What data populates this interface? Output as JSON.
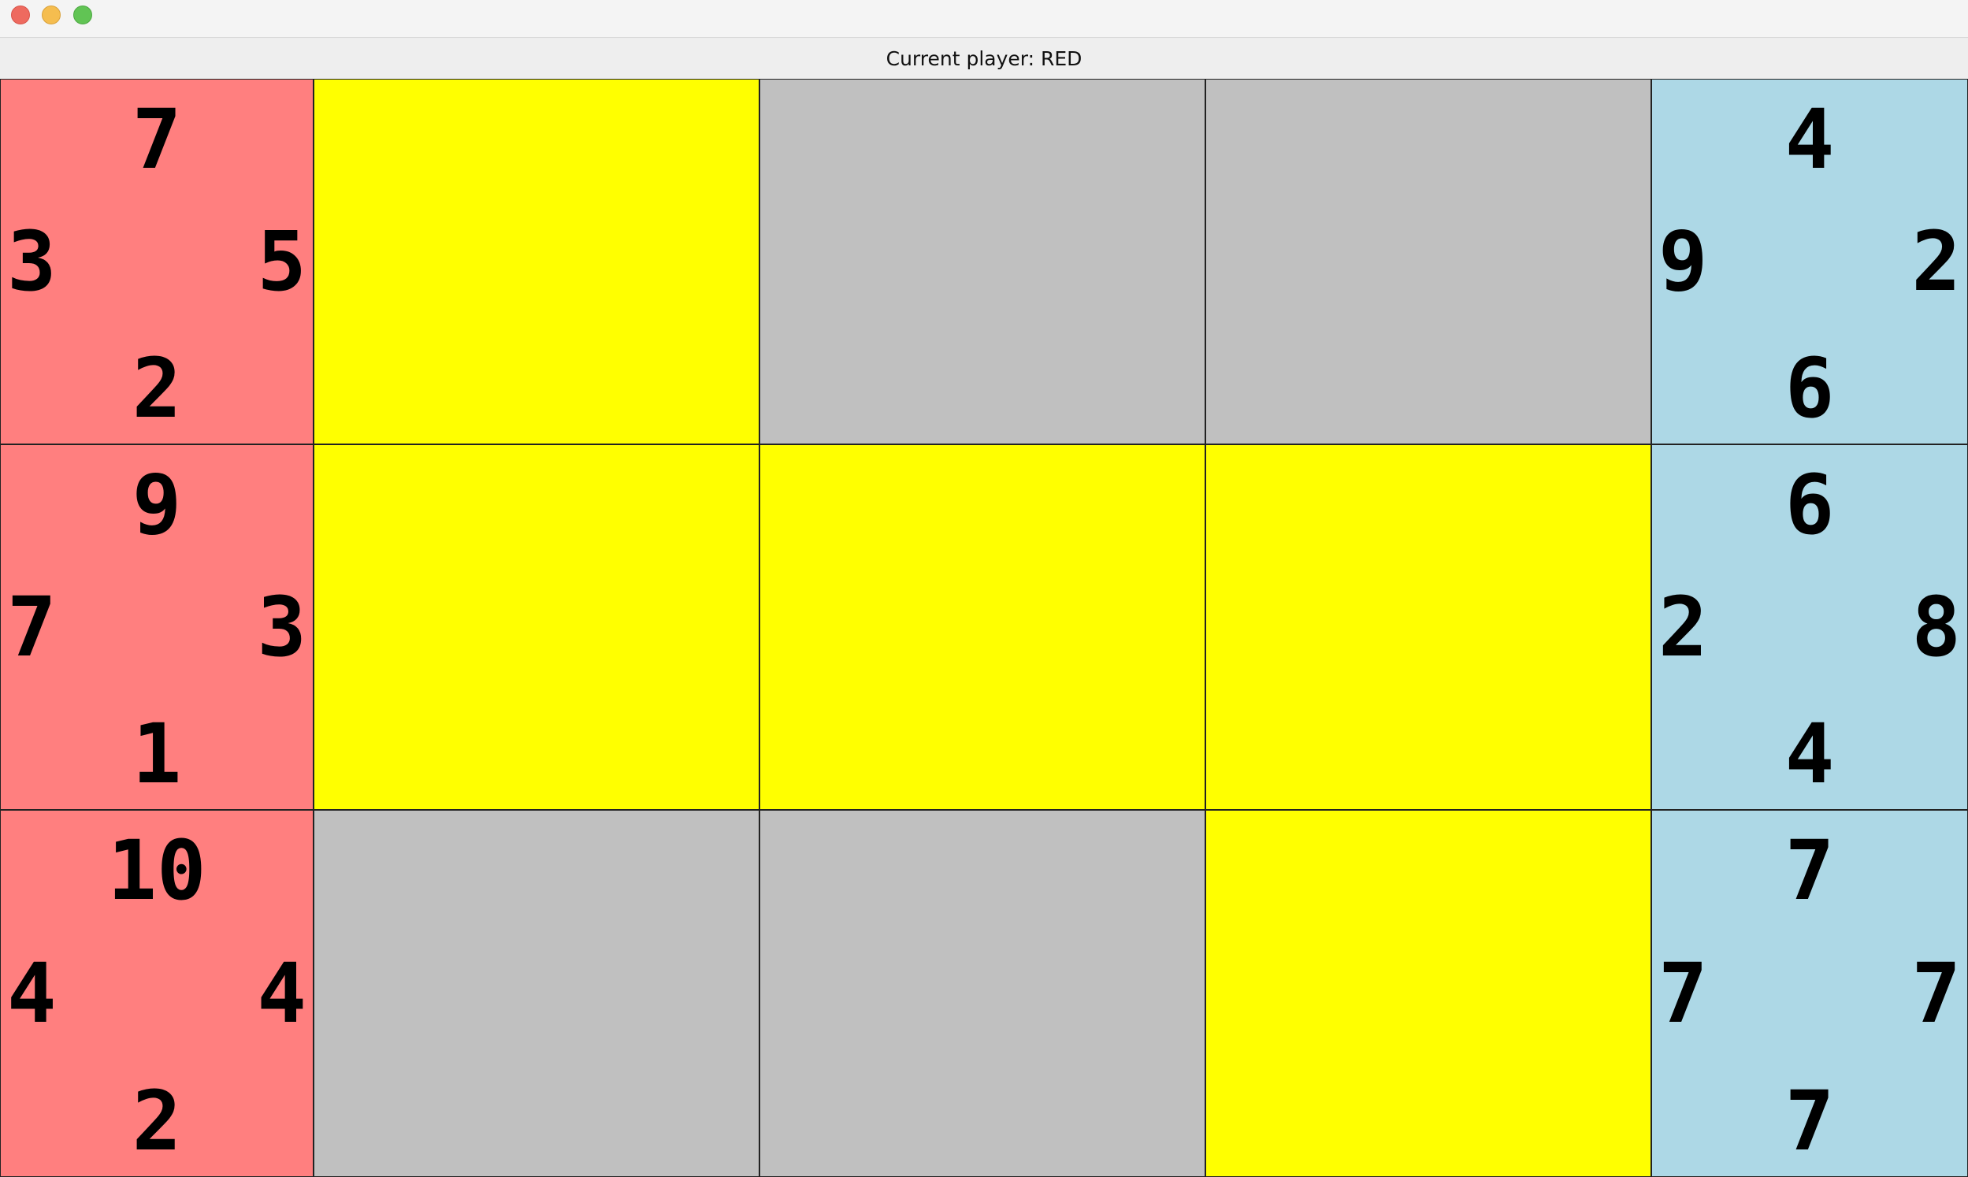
{
  "status": {
    "text": "Current player: RED"
  },
  "colors": {
    "red_player": "#ff7f7f",
    "blue_player": "#add8e6",
    "yellow_cell": "#ffff00",
    "empty_cell": "#c0c0c0"
  },
  "red_hand": [
    {
      "top": "7",
      "left": "3",
      "right": "5",
      "bottom": "2"
    },
    {
      "top": "9",
      "left": "7",
      "right": "3",
      "bottom": "1"
    },
    {
      "top": "10",
      "left": "4",
      "right": "4",
      "bottom": "2"
    }
  ],
  "blue_hand": [
    {
      "top": "4",
      "left": "9",
      "right": "2",
      "bottom": "6"
    },
    {
      "top": "6",
      "left": "2",
      "right": "8",
      "bottom": "4"
    },
    {
      "top": "7",
      "left": "7",
      "right": "7",
      "bottom": "7"
    }
  ],
  "board": [
    [
      "yellow",
      "empty",
      "empty"
    ],
    [
      "yellow",
      "yellow",
      "yellow"
    ],
    [
      "empty",
      "empty",
      "yellow"
    ]
  ]
}
